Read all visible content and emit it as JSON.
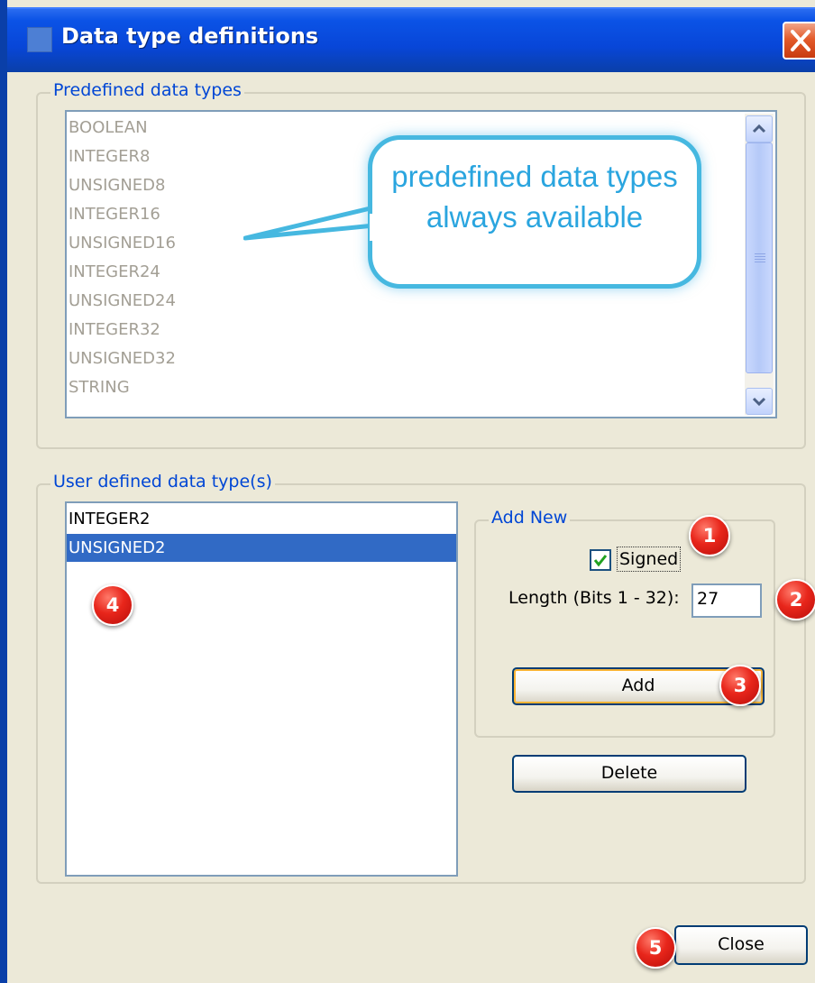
{
  "window": {
    "title": "Data type definitions"
  },
  "predefined": {
    "group_label": "Predefined data types",
    "items": [
      "BOOLEAN",
      "INTEGER8",
      "UNSIGNED8",
      "INTEGER16",
      "UNSIGNED16",
      "INTEGER24",
      "UNSIGNED24",
      "INTEGER32",
      "UNSIGNED32",
      "STRING"
    ]
  },
  "callout": {
    "text": "predefined data types always available"
  },
  "user_defined": {
    "group_label": "User defined data type(s)",
    "items": [
      {
        "label": "INTEGER2",
        "selected": false
      },
      {
        "label": "UNSIGNED2",
        "selected": true
      }
    ]
  },
  "add_new": {
    "group_label": "Add New",
    "signed_label": "Signed",
    "signed_checked": true,
    "length_label": "Length (Bits 1 - 32):",
    "length_value": "27",
    "add_button": "Add"
  },
  "delete_button": "Delete",
  "close_button": "Close",
  "badges": [
    "1",
    "2",
    "3",
    "4",
    "5"
  ],
  "colors": {
    "title_bar": "#0a3fa8",
    "selection": "#316ac5",
    "group_label": "#0046d5",
    "callout": "#2aa5df",
    "badge": "#e8261b",
    "dialog_bg": "#ece9d8"
  }
}
